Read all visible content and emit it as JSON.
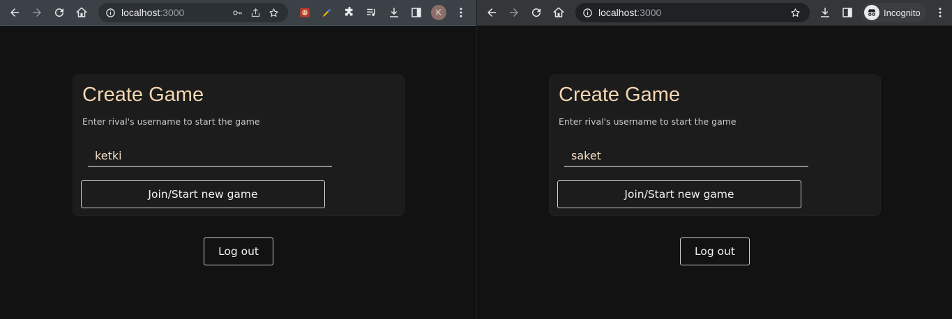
{
  "left_window": {
    "url_host": "localhost",
    "url_port": ":3000",
    "avatar_initial": "K",
    "card": {
      "title": "Create Game",
      "subtitle": "Enter rival's username to start the game",
      "username_value": "ketki",
      "join_label": "Join/Start new game"
    },
    "logout_label": "Log out"
  },
  "right_window": {
    "url_host": "localhost",
    "url_port": ":3000",
    "incognito_label": "Incognito",
    "card": {
      "title": "Create Game",
      "subtitle": "Enter rival's username to start the game",
      "username_value": "saket",
      "join_label": "Join/Start new game"
    },
    "logout_label": "Log out"
  },
  "colors": {
    "page_bg": "#121212",
    "card_bg": "#1b1c1b",
    "title": "#f5d5b2",
    "input_text": "#f3dcc2"
  },
  "icons": [
    "back-icon",
    "forward-icon",
    "reload-icon",
    "home-icon",
    "info-icon",
    "key-icon",
    "share-icon",
    "star-icon",
    "extension-icon",
    "media-icon",
    "download-icon",
    "side-panel-icon",
    "menu-icon",
    "incognito-icon"
  ]
}
